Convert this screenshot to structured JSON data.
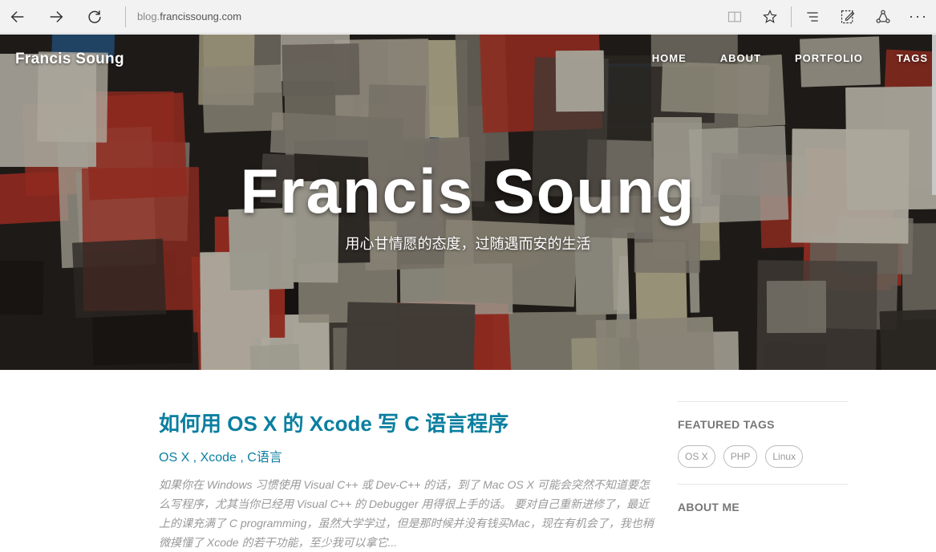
{
  "browser": {
    "url_prefix": "blog.",
    "url_host": "francissoung.com"
  },
  "site": {
    "brand": "Francis Soung",
    "nav": [
      "HOME",
      "ABOUT",
      "PORTFOLIO",
      "TAGS"
    ]
  },
  "hero": {
    "title": "Francis Soung",
    "subtitle": "用心甘情愿的态度，过随遇而安的生活"
  },
  "post": {
    "title": "如何用 OS X 的 Xcode 写 C 语言程序",
    "tags": "OS X , Xcode , C语言",
    "excerpt": "如果你在 Windows 习惯使用 Visual C++ 或 Dev-C++ 的话，到了 Mac OS X 可能会突然不知道要怎么写程序，尤其当你已经用 Visual C++ 的 Debugger 用得很上手的话。 要对自己重新进修了，最近上的课充满了 C programming，虽然大学学过，但是那时候并没有钱买Mac，现在有机会了，我也稍微摸懂了 Xcode 的若干功能，至少我可以拿它..."
  },
  "sidebar": {
    "featured_tags_heading": "FEATURED TAGS",
    "featured_tags": [
      "OS X",
      "PHP",
      "Linux"
    ],
    "about_heading": "ABOUT ME"
  }
}
